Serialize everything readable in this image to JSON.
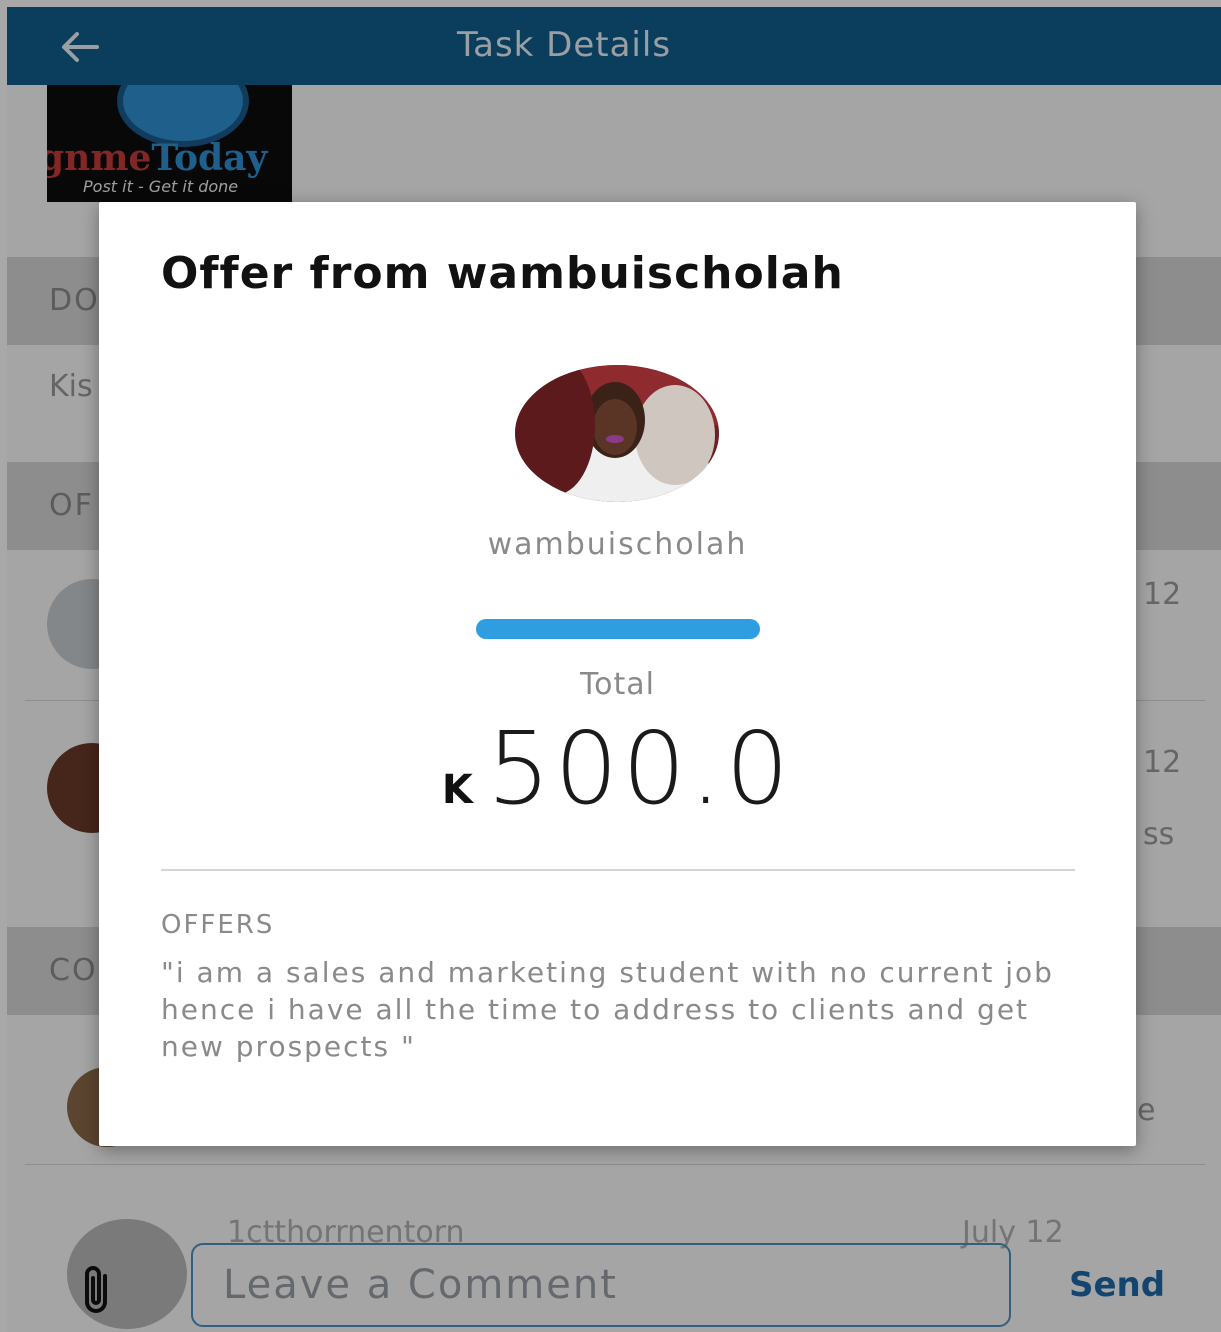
{
  "header": {
    "title": "Task Details",
    "back_icon": "back-arrow-icon"
  },
  "logo": {
    "word_red": "gnme",
    "word_blue": "Today",
    "tagline": "Post it - Get it done"
  },
  "background": {
    "sections": [
      "DO",
      "OF",
      "CO"
    ],
    "location_text": "Kis",
    "dates": [
      "12",
      "12"
    ],
    "snippet": "ss",
    "snippet2": "e",
    "last_row_name": "1ctthorrnentorn",
    "last_row_date": "July 12"
  },
  "comment_bar": {
    "placeholder": "Leave a Comment",
    "send_label": "Send",
    "attach_icon": "paperclip-icon"
  },
  "dialog": {
    "title": "Offer from wambuischolah",
    "username": "wambuischolah",
    "rating_color": "#2e9ee0",
    "total_label": "Total",
    "currency_symbol": "K",
    "amount": "500.0",
    "offers_label": "OFFERS",
    "offer_text": "\"i am a sales and marketing student with no current  job hence i have all the time to address to  clients and  get new prospects  \""
  },
  "colors": {
    "header_bg": "#115e8d",
    "accent": "#2e9ee0",
    "send": "#1f6aa8"
  }
}
